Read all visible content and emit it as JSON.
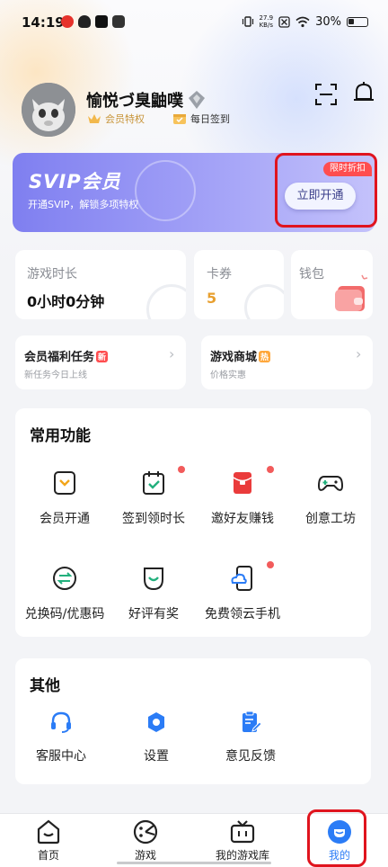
{
  "status_bar": {
    "time": "14:19",
    "net_speed_value": "27.9",
    "net_speed_unit": "KB/s",
    "battery": "30%"
  },
  "profile": {
    "username": "愉悦づ臭鼬噗",
    "vip_label": "会员特权",
    "signin_label": "每日签到"
  },
  "svip": {
    "title": "SVIP会员",
    "subtitle": "开通SVIP，解锁多项特权",
    "badge": "限时折扣",
    "button": "立即开通"
  },
  "stats": {
    "game_time_label": "游戏时长",
    "game_time_value": "0小时0分钟",
    "coupon_label": "卡券",
    "coupon_value": "5",
    "wallet_label": "钱包"
  },
  "tasks": {
    "member": {
      "title": "会员福利任务",
      "tag": "新",
      "sub": "新任务今日上线"
    },
    "mall": {
      "title": "游戏商城",
      "tag": "热",
      "sub": "价格实惠"
    }
  },
  "common": {
    "title": "常用功能",
    "items": [
      {
        "label": "会员开通",
        "icon": "member-open-icon"
      },
      {
        "label": "签到领时长",
        "icon": "calendar-check-icon"
      },
      {
        "label": "邀好友赚钱",
        "icon": "red-envelope-icon"
      },
      {
        "label": "创意工坊",
        "icon": "gamepad-icon"
      },
      {
        "label": "兑换码/优惠码",
        "icon": "exchange-icon"
      },
      {
        "label": "好评有奖",
        "icon": "smile-pocket-icon"
      },
      {
        "label": "免费领云手机",
        "icon": "cloud-phone-icon"
      }
    ]
  },
  "other": {
    "title": "其他",
    "items": [
      {
        "label": "客服中心",
        "icon": "headset-icon"
      },
      {
        "label": "设置",
        "icon": "settings-icon"
      },
      {
        "label": "意见反馈",
        "icon": "feedback-icon"
      }
    ]
  },
  "nav": {
    "items": [
      {
        "label": "首页",
        "icon": "home-icon"
      },
      {
        "label": "游戏",
        "icon": "game-icon"
      },
      {
        "label": "我的游戏库",
        "icon": "game-library-icon"
      },
      {
        "label": "我的",
        "icon": "profile-icon"
      }
    ],
    "active": "我的"
  },
  "colors": {
    "accent": "#2b7cf6",
    "svip_gradient_start": "#7f7ff0",
    "highlight": "#e0141e",
    "coupon_value": "#e8a030"
  }
}
